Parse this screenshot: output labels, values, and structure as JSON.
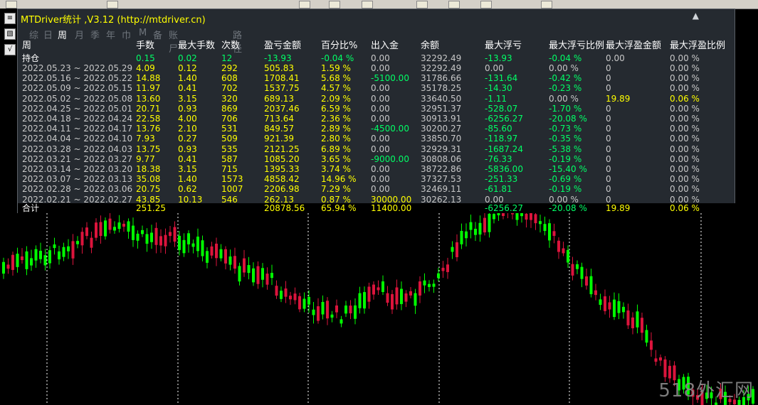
{
  "window": {
    "title": "MTDriver统计 ,V3.12 (http://mtdriver.cn)",
    "close_glyph": "▲"
  },
  "side_buttons": [
    "≡",
    "▧",
    "√"
  ],
  "tabs": [
    "综",
    "日",
    "周",
    "月",
    "季",
    "年",
    "巾",
    "M",
    "备",
    "账尸",
    "路径"
  ],
  "active_tab": "周",
  "table": {
    "headers": [
      "周",
      "手数",
      "最大手数",
      "次数",
      "盈亏金额",
      "百分比%",
      "出入金",
      "余额",
      "最大浮亏",
      "最大浮亏比例",
      "最大浮盈金额",
      "最大浮盈比例"
    ],
    "hold_row": {
      "cells": [
        "持仓",
        "0.15",
        "0.02",
        "12",
        "-13.93",
        "-0.04 %",
        "0.00",
        "32292.49",
        "-13.93",
        "-0.04 %",
        "0.00",
        "0.00 %"
      ],
      "colors": [
        "white",
        "grn",
        "grn",
        "grn",
        "grn",
        "grn",
        "grey",
        "grey",
        "grn",
        "grn",
        "grey",
        "grey"
      ]
    },
    "rows": [
      {
        "cells": [
          "2022.05.23 ~ 2022.05.29",
          "4.09",
          "0.12",
          "292",
          "505.83",
          "1.59 %",
          "0.00",
          "32292.49",
          "0.00",
          "0.00 %",
          "0",
          "0.00 %"
        ],
        "colors": [
          "grey",
          "yel",
          "yel",
          "yel",
          "yel",
          "yel",
          "grey",
          "grey",
          "grey",
          "grey",
          "grey",
          "grey"
        ]
      },
      {
        "cells": [
          "2022.05.16 ~ 2022.05.22",
          "14.88",
          "1.40",
          "608",
          "1708.41",
          "5.68 %",
          "-5100.00",
          "31786.66",
          "-131.64",
          "-0.42 %",
          "0",
          "0.00 %"
        ],
        "colors": [
          "grey",
          "yel",
          "yel",
          "yel",
          "yel",
          "yel",
          "grn",
          "grey",
          "grn",
          "grn",
          "grey",
          "grey"
        ]
      },
      {
        "cells": [
          "2022.05.09 ~ 2022.05.15",
          "11.97",
          "0.41",
          "702",
          "1537.75",
          "4.57 %",
          "0.00",
          "35178.25",
          "-14.30",
          "-0.23 %",
          "0",
          "0.00 %"
        ],
        "colors": [
          "grey",
          "yel",
          "yel",
          "yel",
          "yel",
          "yel",
          "grey",
          "grey",
          "grn",
          "grn",
          "grey",
          "grey"
        ]
      },
      {
        "cells": [
          "2022.05.02 ~ 2022.05.08",
          "13.60",
          "3.15",
          "320",
          "689.13",
          "2.09 %",
          "0.00",
          "33640.50",
          "-1.11",
          "0.00 %",
          "19.89",
          "0.06 %"
        ],
        "colors": [
          "grey",
          "yel",
          "yel",
          "yel",
          "yel",
          "yel",
          "grey",
          "grey",
          "grn",
          "grey",
          "yel",
          "yel"
        ]
      },
      {
        "cells": [
          "2022.04.25 ~ 2022.05.01",
          "20.71",
          "0.93",
          "869",
          "2037.46",
          "6.59 %",
          "0.00",
          "32951.37",
          "-528.07",
          "-1.70 %",
          "0",
          "0.00 %"
        ],
        "colors": [
          "grey",
          "yel",
          "yel",
          "yel",
          "yel",
          "yel",
          "grey",
          "grey",
          "grn",
          "grn",
          "grey",
          "grey"
        ]
      },
      {
        "cells": [
          "2022.04.18 ~ 2022.04.24",
          "22.58",
          "4.00",
          "706",
          "713.64",
          "2.36 %",
          "0.00",
          "30913.91",
          "-6256.27",
          "-20.08 %",
          "0",
          "0.00 %"
        ],
        "colors": [
          "grey",
          "yel",
          "yel",
          "yel",
          "yel",
          "yel",
          "grey",
          "grey",
          "grn",
          "grn",
          "grey",
          "grey"
        ]
      },
      {
        "cells": [
          "2022.04.11 ~ 2022.04.17",
          "13.76",
          "2.10",
          "531",
          "849.57",
          "2.89 %",
          "-4500.00",
          "30200.27",
          "-85.60",
          "-0.73 %",
          "0",
          "0.00 %"
        ],
        "colors": [
          "grey",
          "yel",
          "yel",
          "yel",
          "yel",
          "yel",
          "grn",
          "grey",
          "grn",
          "grn",
          "grey",
          "grey"
        ]
      },
      {
        "cells": [
          "2022.04.04 ~ 2022.04.10",
          "7.93",
          "0.27",
          "509",
          "921.39",
          "2.80 %",
          "0.00",
          "33850.70",
          "-118.97",
          "-0.35 %",
          "0",
          "0.00 %"
        ],
        "colors": [
          "grey",
          "yel",
          "yel",
          "yel",
          "yel",
          "yel",
          "grey",
          "grey",
          "grn",
          "grn",
          "grey",
          "grey"
        ]
      },
      {
        "cells": [
          "2022.03.28 ~ 2022.04.03",
          "13.75",
          "0.93",
          "535",
          "2121.25",
          "6.89 %",
          "0.00",
          "32929.31",
          "-1687.24",
          "-5.38 %",
          "0",
          "0.00 %"
        ],
        "colors": [
          "grey",
          "yel",
          "yel",
          "yel",
          "yel",
          "yel",
          "grey",
          "grey",
          "grn",
          "grn",
          "grey",
          "grey"
        ]
      },
      {
        "cells": [
          "2022.03.21 ~ 2022.03.27",
          "9.77",
          "0.41",
          "587",
          "1085.20",
          "3.65 %",
          "-9000.00",
          "30808.06",
          "-76.33",
          "-0.19 %",
          "0",
          "0.00 %"
        ],
        "colors": [
          "grey",
          "yel",
          "yel",
          "yel",
          "yel",
          "yel",
          "grn",
          "grey",
          "grn",
          "grn",
          "grey",
          "grey"
        ]
      },
      {
        "cells": [
          "2022.03.14 ~ 2022.03.20",
          "18.38",
          "3.15",
          "715",
          "1395.33",
          "3.74 %",
          "0.00",
          "38722.86",
          "-5836.00",
          "-15.40 %",
          "0",
          "0.00 %"
        ],
        "colors": [
          "grey",
          "yel",
          "yel",
          "yel",
          "yel",
          "yel",
          "grey",
          "grey",
          "grn",
          "grn",
          "grey",
          "grey"
        ]
      },
      {
        "cells": [
          "2022.03.07 ~ 2022.03.13",
          "35.08",
          "1.40",
          "1573",
          "4858.42",
          "14.96 %",
          "0.00",
          "37327.53",
          "-251.33",
          "-0.69 %",
          "0",
          "0.00 %"
        ],
        "colors": [
          "grey",
          "yel",
          "yel",
          "yel",
          "yel",
          "yel",
          "grey",
          "grey",
          "grn",
          "grn",
          "grey",
          "grey"
        ]
      },
      {
        "cells": [
          "2022.02.28 ~ 2022.03.06",
          "20.75",
          "0.62",
          "1007",
          "2206.98",
          "7.29 %",
          "0.00",
          "32469.11",
          "-61.81",
          "-0.19 %",
          "0",
          "0.00 %"
        ],
        "colors": [
          "grey",
          "yel",
          "yel",
          "yel",
          "yel",
          "yel",
          "grey",
          "grey",
          "grn",
          "grn",
          "grey",
          "grey"
        ]
      },
      {
        "cells": [
          "2022.02.21 ~ 2022.02.27",
          "43.85",
          "10.13",
          "546",
          "262.13",
          "0.87 %",
          "30000.00",
          "30262.13",
          "0.00",
          "0.00 %",
          "0",
          "0.00 %"
        ],
        "colors": [
          "grey",
          "yel",
          "yel",
          "yel",
          "yel",
          "yel",
          "yel",
          "grey",
          "grey",
          "grey",
          "grey",
          "grey"
        ]
      }
    ],
    "total_row": {
      "cells": [
        "合计",
        "251.25",
        "",
        "",
        "20878.56",
        "65.94 %",
        "11400.00",
        "",
        "-6256.27",
        "-20.08 %",
        "19.89",
        "0.06 %"
      ],
      "colors": [
        "white",
        "yel",
        "yel",
        "yel",
        "yel",
        "yel",
        "yel",
        "grey",
        "grn",
        "grn",
        "yel",
        "yel"
      ]
    }
  },
  "watermark": "518外汇网",
  "colors": {
    "bull": "#dc143c",
    "bear": "#00ff00",
    "panel_bg": "#252a30",
    "highlight": "#ffff00",
    "positive_green": "#00ff66"
  }
}
